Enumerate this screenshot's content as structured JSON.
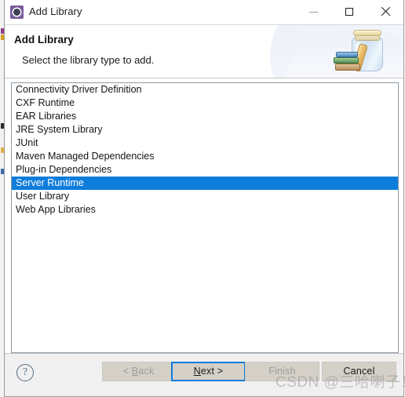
{
  "window": {
    "title": "Add Library",
    "icon": "eclipse-wizard-icon",
    "controls": {
      "minimize": "minimize-icon",
      "maximize": "maximize-icon",
      "close": "close-icon"
    }
  },
  "header": {
    "title": "Add Library",
    "subtitle": "Select the library type to add.",
    "artwork": "library-jar-books-icon"
  },
  "library_list": {
    "items": [
      {
        "label": "Connectivity Driver Definition",
        "selected": false
      },
      {
        "label": "CXF Runtime",
        "selected": false
      },
      {
        "label": "EAR Libraries",
        "selected": false
      },
      {
        "label": "JRE System Library",
        "selected": false
      },
      {
        "label": "JUnit",
        "selected": false
      },
      {
        "label": "Maven Managed Dependencies",
        "selected": false
      },
      {
        "label": "Plug-in Dependencies",
        "selected": false
      },
      {
        "label": "Server Runtime",
        "selected": true
      },
      {
        "label": "User Library",
        "selected": false
      },
      {
        "label": "Web App Libraries",
        "selected": false
      }
    ],
    "selected_value": "Server Runtime",
    "selection_color": "#0f7ddb"
  },
  "footer": {
    "help_icon": "help-question-icon",
    "buttons": [
      {
        "id": "back",
        "label_pre": "< ",
        "label_mnemonic": "B",
        "label_post": "ack",
        "state": "disabled",
        "focused": false
      },
      {
        "id": "next",
        "label_pre": "",
        "label_mnemonic": "N",
        "label_post": "ext >",
        "state": "enabled",
        "focused": true
      },
      {
        "id": "finish",
        "label_pre": "",
        "label_mnemonic": "",
        "label_post": "Finish",
        "state": "disabled",
        "focused": false
      },
      {
        "id": "cancel",
        "label_pre": "",
        "label_mnemonic": "",
        "label_post": "Cancel",
        "state": "enabled",
        "focused": false
      }
    ],
    "focus_color": "#0f7ddb"
  },
  "watermark": {
    "text": "CSDN @三哈喇子！"
  }
}
